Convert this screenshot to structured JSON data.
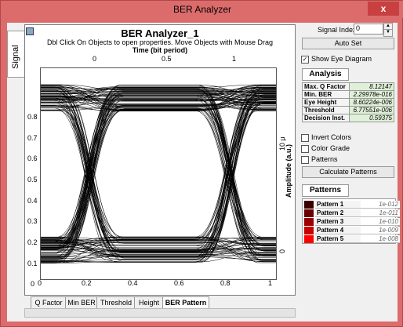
{
  "window": {
    "title": "BER Analyzer",
    "close_glyph": "x"
  },
  "side_tab": {
    "label": "Signal"
  },
  "plot": {
    "title": "BER Analyzer_1",
    "subtitle": "Dbl Click On Objects to open properties.  Move Objects with Mouse Drag",
    "xlabel_top": "Time (bit period)",
    "x_ticks_top": [
      "0",
      "0.5",
      "1"
    ],
    "y_ticks_left": [
      "0.8",
      "0.7",
      "0.6",
      "0.5",
      "0.4",
      "0.3",
      "0.2",
      "0.1",
      "0"
    ],
    "y_ticks_right": [
      "10 μ",
      "0"
    ],
    "ylabel_right": "Amplitude (a.u.)",
    "x_ticks_bottom": [
      "0",
      "0.2",
      "0.4",
      "0.6",
      "0.8",
      "1"
    ]
  },
  "bottom_tabs": [
    {
      "label": "Q Factor"
    },
    {
      "label": "Min BER"
    },
    {
      "label": "Threshold"
    },
    {
      "label": "Height"
    },
    {
      "label": "BER Pattern"
    }
  ],
  "controls": {
    "signal_index_label": "Signal Index:",
    "signal_index_value": "0",
    "auto_set_label": "Auto Set",
    "show_eye_label": "Show Eye Diagram",
    "show_eye_checked": "✓",
    "analysis_header": "Analysis",
    "analysis": [
      {
        "key": "Max. Q Factor",
        "value": "8.12147"
      },
      {
        "key": "Min. BER",
        "value": "2.29978e-016"
      },
      {
        "key": "Eye Height",
        "value": "8.60224e-006"
      },
      {
        "key": "Threshold",
        "value": "6.77551e-006"
      },
      {
        "key": "Decision Inst.",
        "value": "0.59375"
      }
    ],
    "invert_colors_label": "Invert Colors",
    "color_grade_label": "Color Grade",
    "patterns_cb_label": "Patterns",
    "calc_patterns_label": "Calculate Patterns",
    "patterns_header": "Patterns",
    "patterns": [
      {
        "name": "Pattern 1",
        "value": "1e-012",
        "color": "#3a0000"
      },
      {
        "name": "Pattern 2",
        "value": "1e-011",
        "color": "#6a0000"
      },
      {
        "name": "Pattern 3",
        "value": "1e-010",
        "color": "#9a0000"
      },
      {
        "name": "Pattern 4",
        "value": "1e-009",
        "color": "#c80000"
      },
      {
        "name": "Pattern 5",
        "value": "1e-008",
        "color": "#ff0000"
      }
    ]
  }
}
